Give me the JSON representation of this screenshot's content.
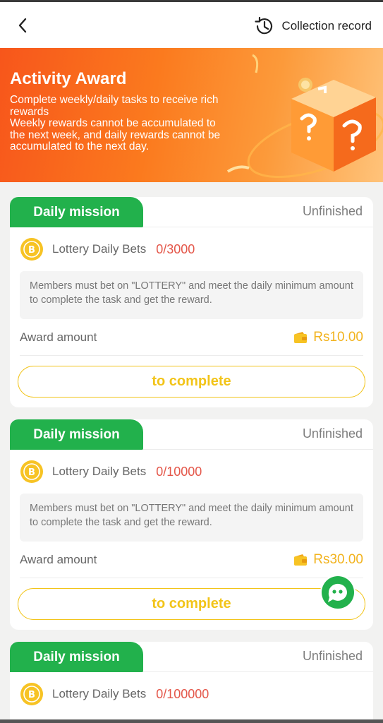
{
  "header": {
    "collection_record_label": "Collection record"
  },
  "banner": {
    "title": "Activity Award",
    "description_lines": [
      "Complete weekly/daily tasks to receive rich rewards",
      "Weekly rewards cannot be accumulated to the next week, and daily rewards cannot be accumulated to the next day."
    ]
  },
  "missions": [
    {
      "tag": "Daily mission",
      "status": "Unfinished",
      "task_name": "Lottery Daily Bets",
      "progress": "0/3000",
      "description": "Members must bet on \"LOTTERY\" and meet the daily minimum amount to complete the task and get the reward.",
      "award_label": "Award amount",
      "award_amount": "Rs10.00",
      "button_label": "to complete"
    },
    {
      "tag": "Daily mission",
      "status": "Unfinished",
      "task_name": "Lottery Daily Bets",
      "progress": "0/10000",
      "description": "Members must bet on \"LOTTERY\" and meet the daily minimum amount to complete the task and get the reward.",
      "award_label": "Award amount",
      "award_amount": "Rs30.00",
      "button_label": "to complete"
    },
    {
      "tag": "Daily mission",
      "status": "Unfinished",
      "task_name": "Lottery Daily Bets",
      "progress": "0/100000"
    }
  ],
  "colors": {
    "primary_green": "#22b14c",
    "accent_orange": "#fb7a1e",
    "progress_red": "#e4574a",
    "gold": "#f2c419"
  },
  "icons": {
    "back": "chevron-left-icon",
    "history": "history-clock-icon",
    "coin": "coin-b-icon",
    "wallet": "wallet-icon",
    "chat": "chat-support-icon"
  }
}
